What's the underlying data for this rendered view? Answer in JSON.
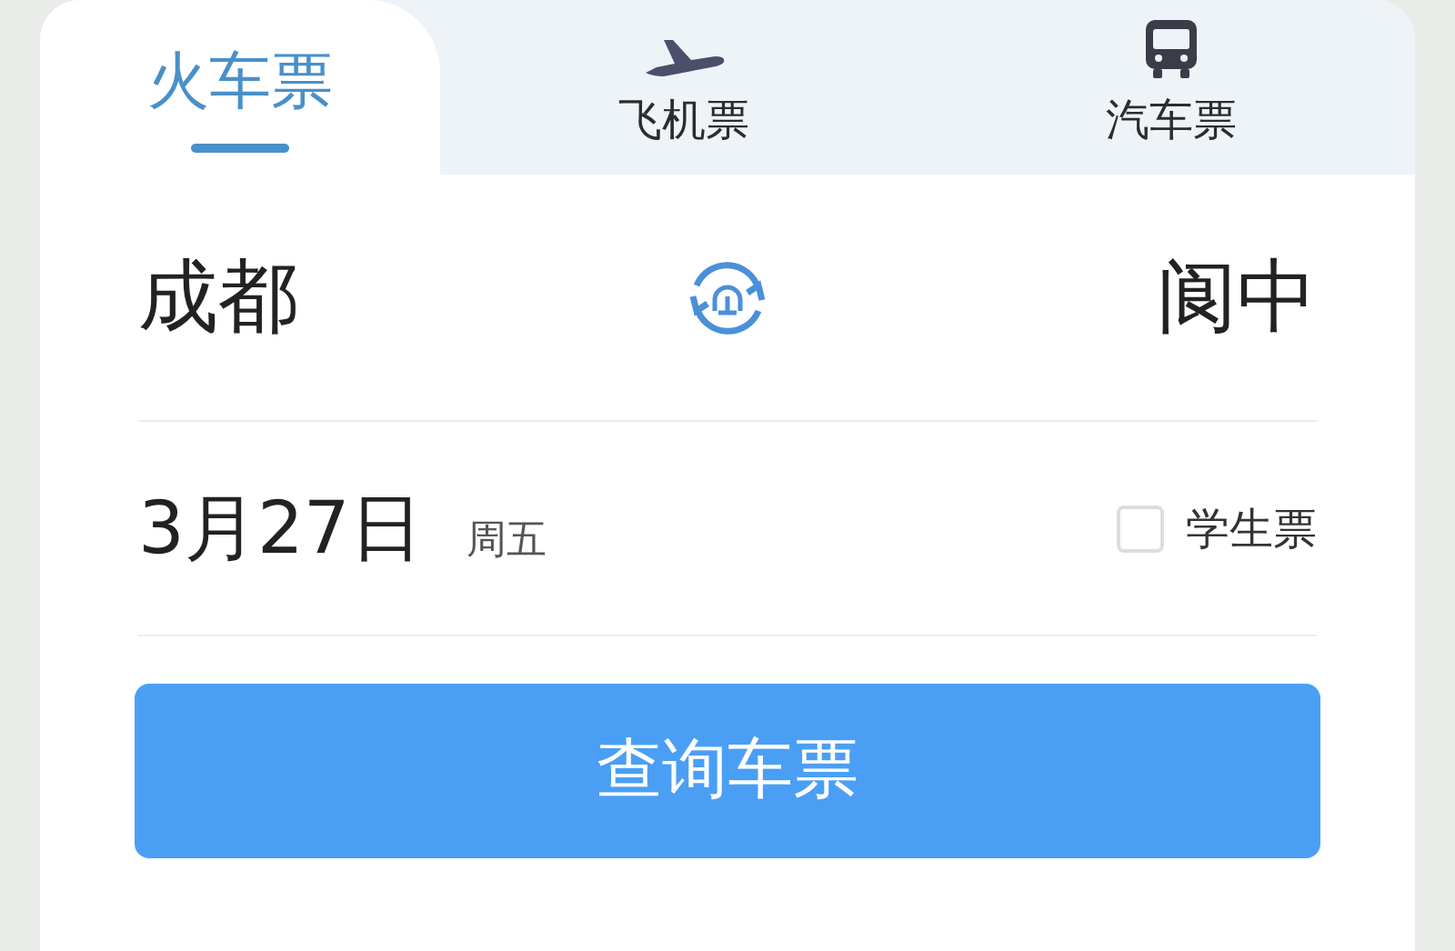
{
  "tabs": [
    {
      "kind": "train",
      "label": "火车票",
      "selected": true
    },
    {
      "kind": "plane",
      "label": "飞机票",
      "selected": false
    },
    {
      "kind": "bus",
      "label": "汽车票",
      "selected": false
    }
  ],
  "route": {
    "from": "成都",
    "to": "阆中"
  },
  "date": {
    "day": "3月27日",
    "weekday": "周五"
  },
  "student_ticket": {
    "label": "学生票",
    "checked": false
  },
  "search_button": "查询车票"
}
